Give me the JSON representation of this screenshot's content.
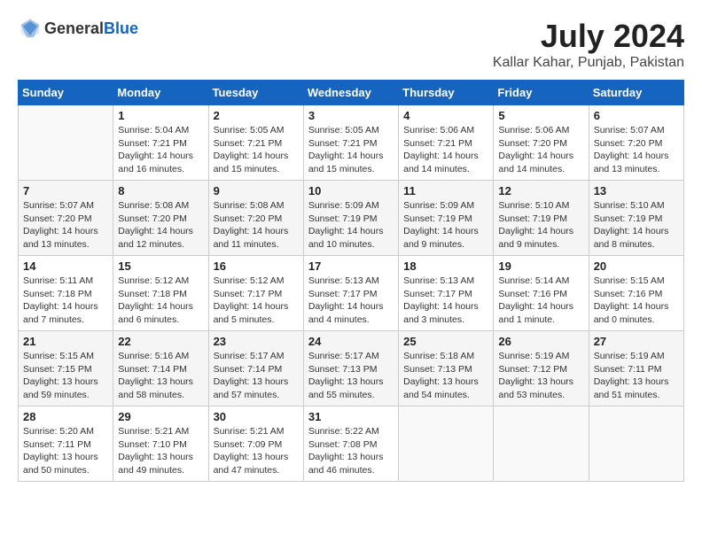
{
  "header": {
    "logo_general": "General",
    "logo_blue": "Blue",
    "month": "July 2024",
    "location": "Kallar Kahar, Punjab, Pakistan"
  },
  "weekdays": [
    "Sunday",
    "Monday",
    "Tuesday",
    "Wednesday",
    "Thursday",
    "Friday",
    "Saturday"
  ],
  "weeks": [
    [
      {
        "day": "",
        "info": ""
      },
      {
        "day": "1",
        "info": "Sunrise: 5:04 AM\nSunset: 7:21 PM\nDaylight: 14 hours\nand 16 minutes."
      },
      {
        "day": "2",
        "info": "Sunrise: 5:05 AM\nSunset: 7:21 PM\nDaylight: 14 hours\nand 15 minutes."
      },
      {
        "day": "3",
        "info": "Sunrise: 5:05 AM\nSunset: 7:21 PM\nDaylight: 14 hours\nand 15 minutes."
      },
      {
        "day": "4",
        "info": "Sunrise: 5:06 AM\nSunset: 7:21 PM\nDaylight: 14 hours\nand 14 minutes."
      },
      {
        "day": "5",
        "info": "Sunrise: 5:06 AM\nSunset: 7:20 PM\nDaylight: 14 hours\nand 14 minutes."
      },
      {
        "day": "6",
        "info": "Sunrise: 5:07 AM\nSunset: 7:20 PM\nDaylight: 14 hours\nand 13 minutes."
      }
    ],
    [
      {
        "day": "7",
        "info": "Sunrise: 5:07 AM\nSunset: 7:20 PM\nDaylight: 14 hours\nand 13 minutes."
      },
      {
        "day": "8",
        "info": "Sunrise: 5:08 AM\nSunset: 7:20 PM\nDaylight: 14 hours\nand 12 minutes."
      },
      {
        "day": "9",
        "info": "Sunrise: 5:08 AM\nSunset: 7:20 PM\nDaylight: 14 hours\nand 11 minutes."
      },
      {
        "day": "10",
        "info": "Sunrise: 5:09 AM\nSunset: 7:19 PM\nDaylight: 14 hours\nand 10 minutes."
      },
      {
        "day": "11",
        "info": "Sunrise: 5:09 AM\nSunset: 7:19 PM\nDaylight: 14 hours\nand 9 minutes."
      },
      {
        "day": "12",
        "info": "Sunrise: 5:10 AM\nSunset: 7:19 PM\nDaylight: 14 hours\nand 9 minutes."
      },
      {
        "day": "13",
        "info": "Sunrise: 5:10 AM\nSunset: 7:19 PM\nDaylight: 14 hours\nand 8 minutes."
      }
    ],
    [
      {
        "day": "14",
        "info": "Sunrise: 5:11 AM\nSunset: 7:18 PM\nDaylight: 14 hours\nand 7 minutes."
      },
      {
        "day": "15",
        "info": "Sunrise: 5:12 AM\nSunset: 7:18 PM\nDaylight: 14 hours\nand 6 minutes."
      },
      {
        "day": "16",
        "info": "Sunrise: 5:12 AM\nSunset: 7:17 PM\nDaylight: 14 hours\nand 5 minutes."
      },
      {
        "day": "17",
        "info": "Sunrise: 5:13 AM\nSunset: 7:17 PM\nDaylight: 14 hours\nand 4 minutes."
      },
      {
        "day": "18",
        "info": "Sunrise: 5:13 AM\nSunset: 7:17 PM\nDaylight: 14 hours\nand 3 minutes."
      },
      {
        "day": "19",
        "info": "Sunrise: 5:14 AM\nSunset: 7:16 PM\nDaylight: 14 hours\nand 1 minute."
      },
      {
        "day": "20",
        "info": "Sunrise: 5:15 AM\nSunset: 7:16 PM\nDaylight: 14 hours\nand 0 minutes."
      }
    ],
    [
      {
        "day": "21",
        "info": "Sunrise: 5:15 AM\nSunset: 7:15 PM\nDaylight: 13 hours\nand 59 minutes."
      },
      {
        "day": "22",
        "info": "Sunrise: 5:16 AM\nSunset: 7:14 PM\nDaylight: 13 hours\nand 58 minutes."
      },
      {
        "day": "23",
        "info": "Sunrise: 5:17 AM\nSunset: 7:14 PM\nDaylight: 13 hours\nand 57 minutes."
      },
      {
        "day": "24",
        "info": "Sunrise: 5:17 AM\nSunset: 7:13 PM\nDaylight: 13 hours\nand 55 minutes."
      },
      {
        "day": "25",
        "info": "Sunrise: 5:18 AM\nSunset: 7:13 PM\nDaylight: 13 hours\nand 54 minutes."
      },
      {
        "day": "26",
        "info": "Sunrise: 5:19 AM\nSunset: 7:12 PM\nDaylight: 13 hours\nand 53 minutes."
      },
      {
        "day": "27",
        "info": "Sunrise: 5:19 AM\nSunset: 7:11 PM\nDaylight: 13 hours\nand 51 minutes."
      }
    ],
    [
      {
        "day": "28",
        "info": "Sunrise: 5:20 AM\nSunset: 7:11 PM\nDaylight: 13 hours\nand 50 minutes."
      },
      {
        "day": "29",
        "info": "Sunrise: 5:21 AM\nSunset: 7:10 PM\nDaylight: 13 hours\nand 49 minutes."
      },
      {
        "day": "30",
        "info": "Sunrise: 5:21 AM\nSunset: 7:09 PM\nDaylight: 13 hours\nand 47 minutes."
      },
      {
        "day": "31",
        "info": "Sunrise: 5:22 AM\nSunset: 7:08 PM\nDaylight: 13 hours\nand 46 minutes."
      },
      {
        "day": "",
        "info": ""
      },
      {
        "day": "",
        "info": ""
      },
      {
        "day": "",
        "info": ""
      }
    ]
  ]
}
